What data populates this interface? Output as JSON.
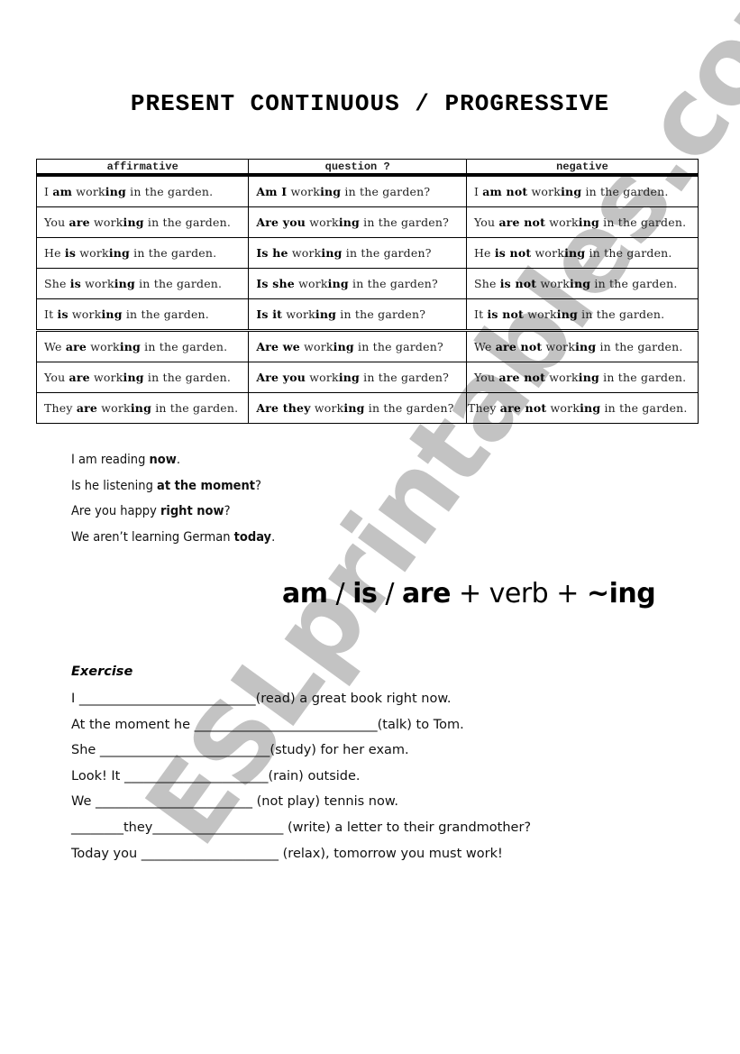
{
  "title": "PRESENT CONTINUOUS / PROGRESSIVE",
  "table": {
    "headers": [
      "affirmative",
      "question ?",
      "negative"
    ],
    "rows": [
      {
        "aff": [
          " I ",
          "am",
          " work",
          "ing",
          " in the garden."
        ],
        "q": [
          "Am I",
          " work",
          "ing",
          " in the garden?"
        ],
        "neg": [
          "I ",
          "am not",
          " work",
          "ing",
          " in the garden."
        ]
      },
      {
        "aff": [
          "You ",
          "are",
          " work",
          "ing",
          " in the garden."
        ],
        "q": [
          "Are you",
          " work",
          "ing",
          " in the garden?"
        ],
        "neg": [
          "You ",
          "are not",
          " work",
          "ing",
          " in the garden."
        ]
      },
      {
        "aff": [
          "He ",
          "is",
          " work",
          "ing",
          " in the garden."
        ],
        "q": [
          "Is he",
          " work",
          "ing",
          " in the garden?"
        ],
        "neg": [
          "He ",
          "is not",
          " work",
          "ing",
          " in the garden."
        ]
      },
      {
        "aff": [
          "She ",
          "is",
          " work",
          "ing",
          " in the garden."
        ],
        "q": [
          "Is she",
          " work",
          "ing",
          " in the garden?"
        ],
        "neg": [
          "She ",
          "is not",
          " work",
          "ing",
          " in the garden."
        ]
      },
      {
        "aff": [
          "It ",
          "is",
          " work",
          "ing",
          " in the garden."
        ],
        "q": [
          "Is it",
          " work",
          "ing",
          " in the garden?"
        ],
        "neg": [
          "It ",
          "is not",
          " work",
          "ing",
          " in the garden."
        ]
      },
      {
        "aff": [
          "We ",
          "are",
          " work",
          "ing",
          " in the garden."
        ],
        "q": [
          "Are we",
          " work",
          "ing",
          " in the garden?"
        ],
        "neg": [
          "We ",
          "are not",
          " work",
          "ing",
          " in the garden."
        ]
      },
      {
        "aff": [
          "You ",
          "are",
          " work",
          "ing",
          " in the garden."
        ],
        "q": [
          "Are you",
          " work",
          "ing",
          " in the garden?"
        ],
        "neg": [
          "You ",
          "are not",
          " work",
          "ing",
          " in the garden."
        ]
      },
      {
        "aff": [
          "They ",
          "are",
          " work",
          "ing",
          " in the garden."
        ],
        "q": [
          "Are they",
          " work",
          "ing",
          " in the garden?"
        ],
        "neg": [
          "They ",
          "are not",
          " work",
          "ing",
          " in the garden."
        ]
      }
    ]
  },
  "examples": [
    {
      "plain": "I am reading ",
      "bold": "now",
      "end": "."
    },
    {
      "plain": "Is he listening ",
      "bold": "at the moment",
      "end": "?"
    },
    {
      "plain": "Are you happy ",
      "bold": "right now",
      "end": "?"
    },
    {
      "plain": "We aren’t learning German ",
      "bold": "today",
      "end": "."
    }
  ],
  "formula": {
    "am": "am",
    "sep1": " / ",
    "is": "is",
    "sep2": " / ",
    "are": "are",
    "mid": " + verb + ",
    "ing": "~ing"
  },
  "exercise": {
    "heading": "Exercise",
    "lines": [
      "I ___________________________(read) a great book right now.",
      "At the moment he ____________________________(talk) to Tom.",
      "She __________________________(study) for her exam.",
      "Look! It ______________________(rain) outside.",
      "We ________________________ (not play) tennis now.",
      "________they____________________ (write) a letter to their grandmother?",
      "Today you _____________________ (relax), tomorrow you must work!"
    ]
  },
  "watermark": "ESLprintables.com"
}
